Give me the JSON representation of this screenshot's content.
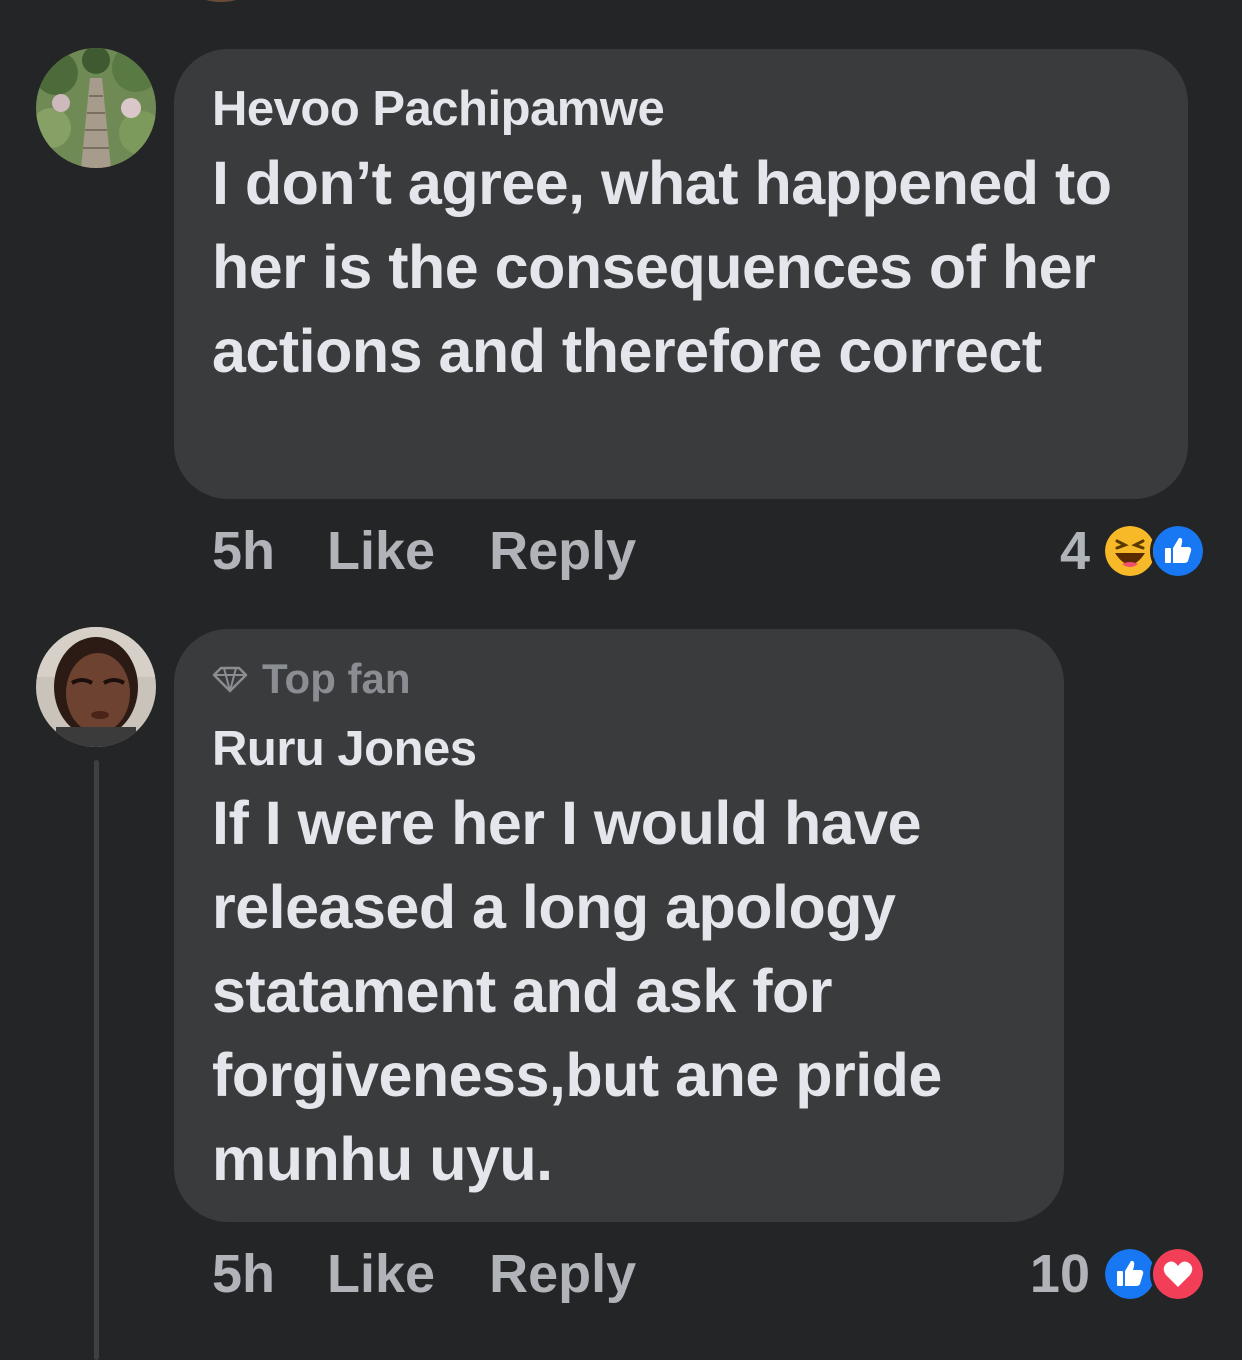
{
  "colors": {
    "background": "#242526",
    "bubble": "#3a3b3c",
    "primary_text": "#e4e6eb",
    "secondary_text": "#b0b3b8",
    "like_blue": "#1877f2",
    "love_red": "#f33e58",
    "haha_yellow": "#f7b928"
  },
  "comments": [
    {
      "author": "Hevoo Pachipamwe",
      "text": "I don’t agree, what happened to her is the consequences of her actions and therefore correct",
      "time": "5h",
      "like_label": "Like",
      "reply_label": "Reply",
      "reaction_count": "4",
      "reaction_icons": [
        "haha-icon",
        "like-icon"
      ]
    },
    {
      "badge": "Top fan",
      "badge_icon": "diamond-icon",
      "author": "Ruru Jones",
      "text": "If I were her I would have released a long apology statament and ask for forgiveness,but ane pride munhu uyu.",
      "time": "5h",
      "like_label": "Like",
      "reply_label": "Reply",
      "reaction_count": "10",
      "reaction_icons": [
        "like-icon",
        "love-icon"
      ]
    }
  ]
}
